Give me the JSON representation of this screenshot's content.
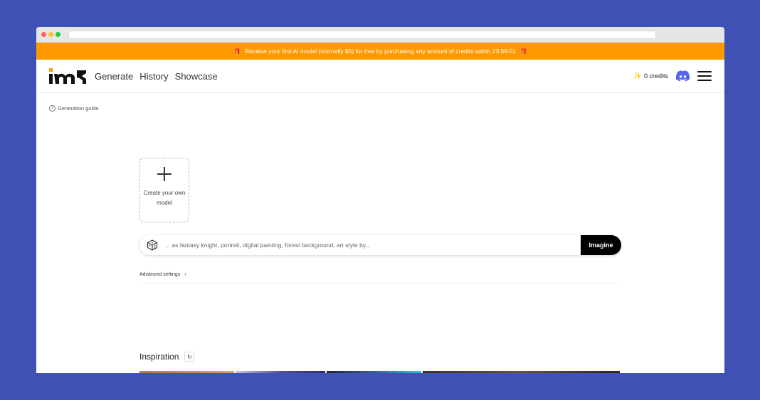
{
  "promo": {
    "text": "Receive your first AI model (normally $5) for free by purchasing any amount of credits within 23:59:01",
    "icon": "gift-icon"
  },
  "nav": {
    "links": [
      "Generate",
      "History",
      "Showcase"
    ],
    "credits": "0 credits"
  },
  "guide": {
    "label": "Generation guide"
  },
  "create_card": {
    "label": "Create your own model"
  },
  "prompt": {
    "placeholder": "... as fantasy knight, portrait, digital painting, forest background, art style by...",
    "button": "Imagine"
  },
  "advanced": {
    "label": "Advanced settings",
    "chevron": "›"
  },
  "inspiration": {
    "title": "Inspiration"
  },
  "colors": {
    "promo_bg": "#ff9900",
    "background": "#3f51b5",
    "discord": "#5865f2"
  }
}
